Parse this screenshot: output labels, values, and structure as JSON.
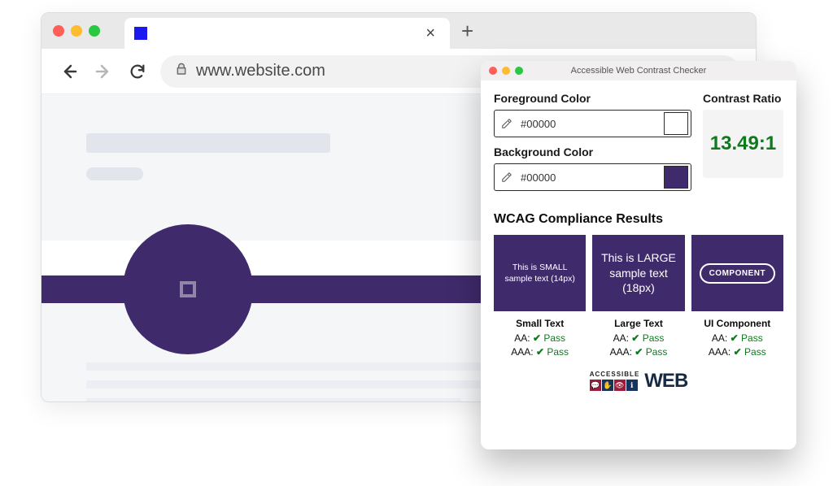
{
  "browser": {
    "tab_title": "",
    "tab_close_glyph": "×",
    "new_tab_glyph": "+",
    "url": "www.website.com"
  },
  "checker": {
    "title": "Accessible Web Contrast Checker",
    "foreground": {
      "label": "Foreground Color",
      "value": "#00000",
      "swatch": "#ffffff"
    },
    "background": {
      "label": "Background Color",
      "value": "#00000",
      "swatch": "#3f2a6b"
    },
    "ratio": {
      "label": "Contrast Ratio",
      "value": "13.49:1"
    },
    "results_header": "WCAG Compliance Results",
    "tiles": {
      "small": {
        "sample": "This is SMALL sample text (14px)",
        "label": "Small Text",
        "aa": "Pass",
        "aaa": "Pass"
      },
      "large": {
        "sample": "This is LARGE sample text (18px)",
        "label": "Large Text",
        "aa": "Pass",
        "aaa": "Pass"
      },
      "component": {
        "sample": "COMPONENT",
        "label": "UI Component",
        "aa": "Pass",
        "aaa": "Pass"
      }
    },
    "levels": {
      "aa": "AA:",
      "aaa": "AAA:"
    },
    "check_glyph": "✔",
    "logo": {
      "accessible": "ACCESSIBLE",
      "web": "WEB"
    }
  },
  "colors": {
    "purple": "#3f2a6b",
    "pass_green": "#0e7a1d"
  }
}
